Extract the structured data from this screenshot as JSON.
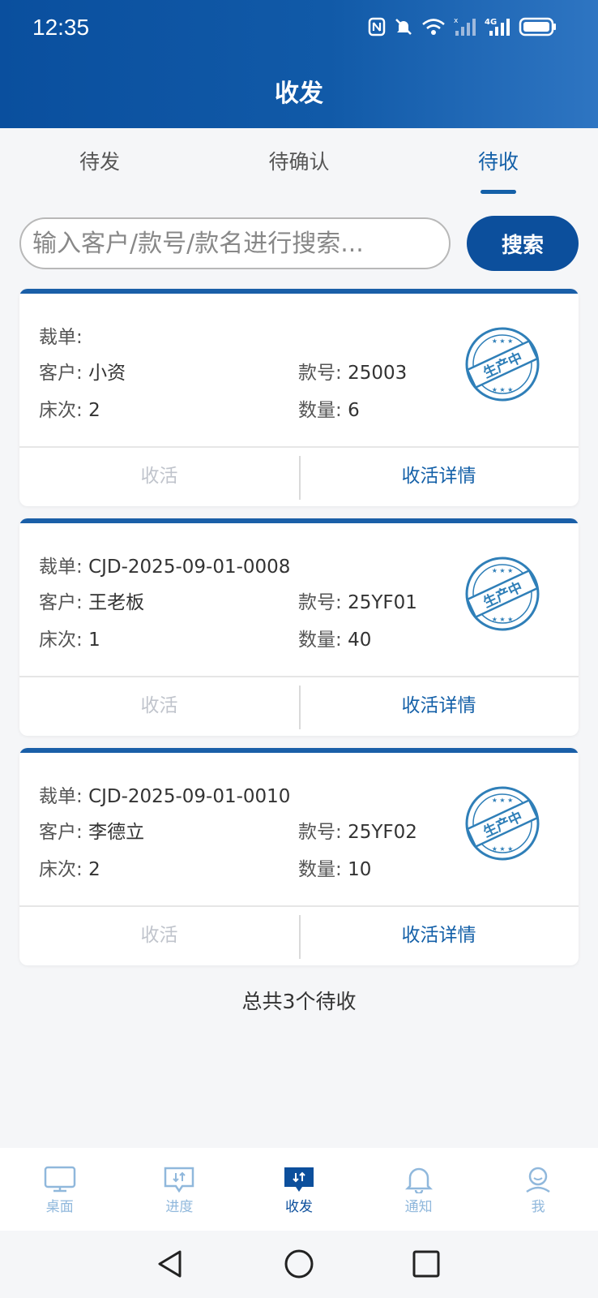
{
  "status_bar": {
    "time": "12:35",
    "network": "4G"
  },
  "header": {
    "title": "收发"
  },
  "tabs": [
    {
      "label": "待发",
      "active": false
    },
    {
      "label": "待确认",
      "active": false
    },
    {
      "label": "待收",
      "active": true
    }
  ],
  "search": {
    "placeholder": "输入客户/款号/款名进行搜索...",
    "button_label": "搜索"
  },
  "labels": {
    "cut": "裁单:",
    "customer": "客户:",
    "style": "款号:",
    "bed": "床次:",
    "qty": "数量:"
  },
  "cards": [
    {
      "cut_no": "",
      "customer": "小资",
      "style_no": "25003",
      "bed": "2",
      "qty": "6",
      "stamp": "生产中",
      "receive_label": "收活",
      "detail_label": "收活详情"
    },
    {
      "cut_no": "CJD-2025-09-01-0008",
      "customer": "王老板",
      "style_no": "25YF01",
      "bed": "1",
      "qty": "40",
      "stamp": "生产中",
      "receive_label": "收活",
      "detail_label": "收活详情"
    },
    {
      "cut_no": "CJD-2025-09-01-0010",
      "customer": "李德立",
      "style_no": "25YF02",
      "bed": "2",
      "qty": "10",
      "stamp": "生产中",
      "receive_label": "收活",
      "detail_label": "收活详情"
    }
  ],
  "total_text": "总共3个待收",
  "bottom_nav": [
    {
      "label": "桌面",
      "icon": "desktop-icon",
      "active": false
    },
    {
      "label": "进度",
      "icon": "progress-icon",
      "active": false
    },
    {
      "label": "收发",
      "icon": "transfer-icon",
      "active": true
    },
    {
      "label": "通知",
      "icon": "bell-icon",
      "active": false
    },
    {
      "label": "我",
      "icon": "user-icon",
      "active": false
    }
  ],
  "colors": {
    "primary": "#0c4f9c",
    "accent": "#1460a8",
    "disabled": "#c0c4cc",
    "nav_inactive": "#90b8dc"
  }
}
